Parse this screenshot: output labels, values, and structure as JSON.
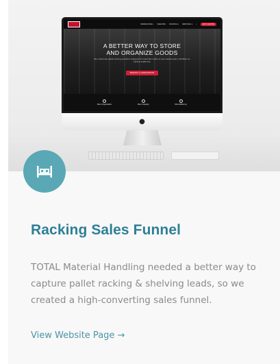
{
  "mockup": {
    "site_nav_items": [
      "WAREHOUSE ▾",
      "SHELVING",
      "RACKING ▾",
      "SERVICES ▾"
    ],
    "site_nav_cta": "GET A QUOTE",
    "site_headline_line1": "A BETTER WAY TO STORE",
    "site_headline_line2": "AND ORGANIZE GOODS",
    "site_subtext": "We customize pallet racking solutions designed to meet the needs of your warehouse in Northern & Central California.",
    "site_button": "REQUEST A CONSULTATION",
    "site_features": [
      "More Organization",
      "More Capacity",
      "More Efficiency"
    ]
  },
  "badge": {
    "icon": "pallet-rack-icon",
    "color": "#5aa8b6"
  },
  "card": {
    "title": "Racking Sales Funnel",
    "description": "TOTAL Material Handling needed a better way to capture pallet racking & shelving leads, so we created a high-converting sales funnel.",
    "link_label": "View Website Page →"
  },
  "colors": {
    "title": "#2e7f96",
    "link": "#4a94a8",
    "body_text": "#8a8a8a",
    "accent_red": "#d21f36"
  }
}
